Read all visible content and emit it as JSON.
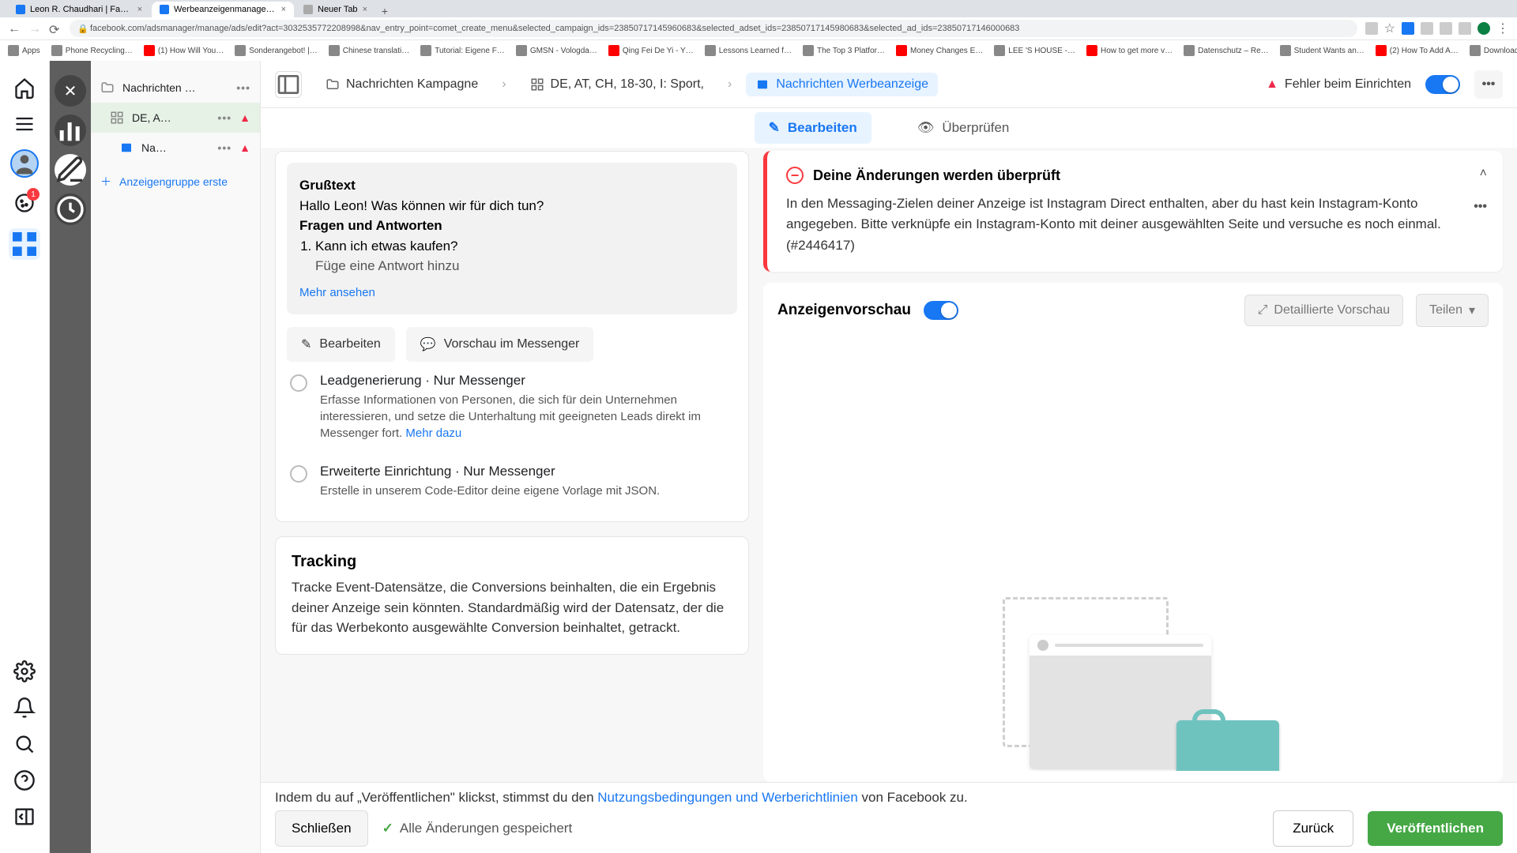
{
  "browser": {
    "tabs": [
      {
        "title": "Leon R. Chaudhari | Facebook",
        "active": false
      },
      {
        "title": "Werbeanzeigenmanager - We",
        "active": true
      },
      {
        "title": "Neuer Tab",
        "active": false
      }
    ],
    "url": "facebook.com/adsmanager/manage/ads/edit?act=3032535772208998&nav_entry_point=comet_create_menu&selected_campaign_ids=23850717145960683&selected_adset_ids=23850717145980683&selected_ad_ids=23850717146000683",
    "bookmarks": [
      "Apps",
      "Phone Recycling…",
      "(1) How Will You…",
      "Sonderangebot! |…",
      "Chinese translati…",
      "Tutorial: Eigene F…",
      "GMSN - Vologda…",
      "Qing Fei De Yi - Y…",
      "Lessons Learned f…",
      "The Top 3 Platfor…",
      "Money Changes E…",
      "LEE 'S HOUSE -…",
      "How to get more v…",
      "Datenschutz – Re…",
      "Student Wants an…",
      "(2) How To Add A…",
      "Download - Cooki…"
    ]
  },
  "leftRail": {
    "cookieBadge": "1"
  },
  "tree": {
    "campaign": "Nachrichten …",
    "adset": "DE, A…",
    "ad": "Na…",
    "addGroup": "Anzeigengruppe erste"
  },
  "crumbs": {
    "c1": "Nachrichten Kampagne",
    "c2": "DE, AT, CH, 18-30, I: Sport,",
    "c3": "Nachrichten Werbeanzeige",
    "status": "Fehler beim Einrichten"
  },
  "tabs": {
    "edit": "Bearbeiten",
    "review": "Überprüfen"
  },
  "greeting": {
    "h1": "Grußtext",
    "line": "Hallo Leon! Was können wir für dich tun?",
    "h2": "Fragen und Antworten",
    "q1": "Kann ich etwas kaufen?",
    "a1": "Füge eine Antwort hinzu",
    "more": "Mehr ansehen",
    "editBtn": "Bearbeiten",
    "previewBtn": "Vorschau im Messenger"
  },
  "options": {
    "lead": {
      "title": "Leadgenerierung · Nur Messenger",
      "desc": "Erfasse Informationen von Personen, die sich für dein Unternehmen interessieren, und setze die Unterhaltung mit geeigneten Leads direkt im Messenger fort. ",
      "more": "Mehr dazu"
    },
    "adv": {
      "title": "Erweiterte Einrichtung · Nur Messenger",
      "desc": "Erstelle in unserem Code-Editor deine eigene Vorlage mit JSON."
    }
  },
  "tracking": {
    "h": "Tracking",
    "d": "Tracke Event-Datensätze, die Conversions beinhalten, die ein Ergebnis deiner Anzeige sein könnten. Standardmäßig wird der Datensatz, der die für das Werbekonto ausgewählte Conversion beinhaltet, getrackt."
  },
  "alert": {
    "title": "Deine Änderungen werden überprüft",
    "body": "In den Messaging-Zielen deiner Anzeige ist Instagram Direct enthalten, aber du hast kein Instagram-Konto angegeben. Bitte verknüpfe ein Instagram-Konto mit deiner ausgewählten Seite und versuche es noch einmal. (#2446417)"
  },
  "preview": {
    "title": "Anzeigenvorschau",
    "detailBtn": "Detaillierte Vorschau",
    "shareBtn": "Teilen"
  },
  "footer": {
    "consent_pre": "Indem du auf „Veröffentlichen\" klickst, stimmst du den ",
    "consent_link": "Nutzungsbedingungen und Werberichtlinien",
    "consent_post": " von Facebook zu.",
    "close": "Schließen",
    "saved": "Alle Änderungen gespeichert",
    "back": "Zurück",
    "publish": "Veröffentlichen"
  }
}
